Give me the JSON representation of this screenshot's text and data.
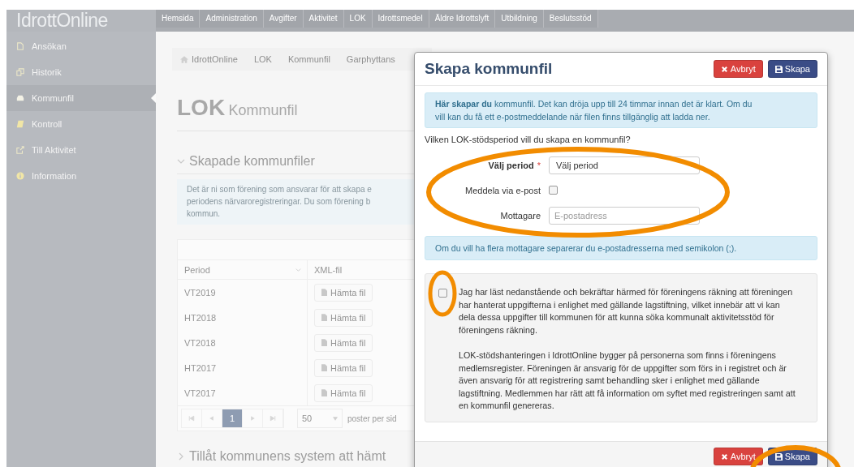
{
  "logo": "IdrottOnline",
  "nav": [
    "Hemsida",
    "Administration",
    "Avgifter",
    "Aktivitet",
    "LOK",
    "Idrottsmedel",
    "Äldre Idrottslyft",
    "Utbildning",
    "Beslutsstöd"
  ],
  "sidebar": {
    "items": [
      {
        "label": "Ansökan",
        "kind": "file",
        "selected": false
      },
      {
        "label": "Historik",
        "kind": "history",
        "selected": false
      },
      {
        "label": "Kommunfil",
        "kind": "inbox",
        "selected": true
      },
      {
        "label": "Kontroll",
        "kind": "book",
        "selected": false
      },
      {
        "label": "Till Aktivitet",
        "kind": "external",
        "selected": false
      },
      {
        "label": "Information",
        "kind": "info",
        "selected": false
      }
    ]
  },
  "breadcrumb": [
    "IdrottOnline",
    "LOK",
    "Kommunfil",
    "Garphyttans"
  ],
  "page_title": {
    "main": "LOK",
    "sub": "Kommunfil"
  },
  "sections": [
    {
      "title": "Skapade kommunfiler",
      "expanded": true
    },
    {
      "title": "Tillåt kommunens system att hämt",
      "expanded": false
    }
  ],
  "info_text": "Det är ni som förening som ansvarar för att skapa e\nperiodens närvaroregistreringar. Du som förening b\nkommun.",
  "table": {
    "columns": [
      "Period",
      "XML-fil"
    ],
    "rows": [
      {
        "period": "VT2019",
        "button": "Hämta fil"
      },
      {
        "period": "HT2018",
        "button": "Hämta fil"
      },
      {
        "period": "VT2018",
        "button": "Hämta fil"
      },
      {
        "period": "HT2017",
        "button": "Hämta fil"
      },
      {
        "period": "VT2017",
        "button": "Hämta fil"
      }
    ],
    "pager": {
      "pages": [
        {
          "label": "1",
          "selected": true
        }
      ],
      "page_size": "50",
      "page_size_label": "poster per sid"
    }
  },
  "dialog": {
    "title": "Skapa kommunfil",
    "header_buttons": [
      {
        "label": "Avbryt",
        "kind": "cancel"
      },
      {
        "label": "Skapa",
        "kind": "save"
      }
    ],
    "intro": "**Här skapar du** kommunfil. Det kan dröja upp till 24 timmar innan det är klart. Om du vill kan du få ett e-postmeddelande när filen finns tillgänglig att ladda ner.",
    "question": "Vilken LOK-stödsperiod vill du skapa en kommunfil?",
    "fields": [
      {
        "kind": "select",
        "label": "Välj period",
        "required_mark": "*",
        "value": "Välj period"
      },
      {
        "kind": "checkbox",
        "label": "Meddela via e-post",
        "checked": false
      },
      {
        "kind": "text",
        "label": "Mottagare",
        "placeholder": "E-postadress"
      }
    ],
    "hint": "Om du vill ha flera mottagare separerar du e-postadresserna med semikolon (;).",
    "consent": {
      "checked": false,
      "paragraphs": [
        "Jag har läst nedanstående och bekräftar härmed för föreningens räkning att föreningen har hanterat uppgifterna i enlighet med gällande lagstiftning, vilket innebär att vi kan dela dessa uppgifter till kommunen för att kunna söka kommunalt aktivitetsstöd för föreningens räkning.",
        "LOK-stödshanteringen i IdrottOnline bygger på personerna som finns i föreningens medlemsregister. Föreningen är ansvarig för de uppgifter som förs in i registret och är även ansvarig för att registrering samt behandling sker i enlighet med gällande lagstiftning. Medlemmen har rätt att få information om syftet med registreringen samt att en kommunfil genereras."
      ]
    },
    "footer_buttons": [
      {
        "label": "Avbryt",
        "kind": "cancel"
      },
      {
        "label": "Skapa",
        "kind": "save"
      }
    ]
  }
}
